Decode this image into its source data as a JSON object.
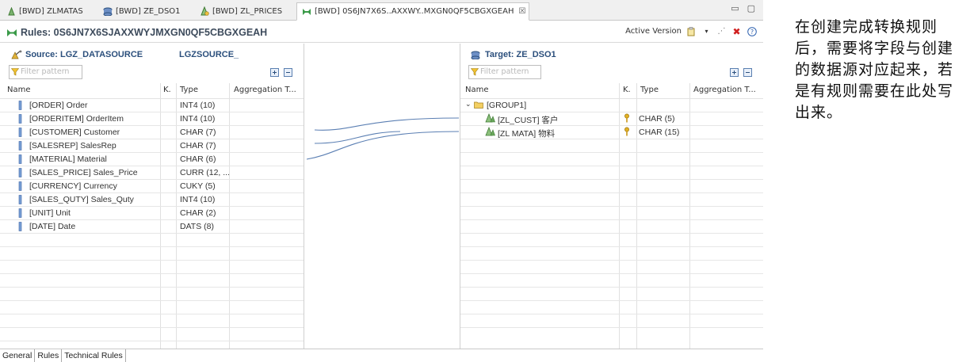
{
  "tabs": [
    {
      "label": "[BWD] ZLMATAS",
      "icon": "transformation-icon",
      "active": false
    },
    {
      "label": "[BWD] ZE_DSO1",
      "icon": "datastore-icon",
      "active": false
    },
    {
      "label": "[BWD] ZL_PRICES",
      "icon": "infoobject-icon",
      "active": false
    },
    {
      "label": "[BWD] 0S6JN7X6S..AXXWY..MXGN0QF5CBGXGEAH",
      "icon": "rules-icon",
      "active": true
    }
  ],
  "header": {
    "title": "Rules: 0S6JN7X6SJAXXWYJMXGN0QF5CBGXGEAH",
    "active_version_label": "Active Version"
  },
  "source": {
    "title": "Source: LGZ_DATASOURCE",
    "subtitle": "LGZSOURCE_",
    "filter_placeholder": "Filter pattern",
    "columns": {
      "name": "Name",
      "key": "K.",
      "type": "Type",
      "agg": "Aggregation T..."
    },
    "rows": [
      {
        "name": "[ORDER] Order",
        "type": "INT4 (10)"
      },
      {
        "name": "[ORDERITEM] OrderItem",
        "type": "INT4 (10)"
      },
      {
        "name": "[CUSTOMER] Customer",
        "type": "CHAR (7)"
      },
      {
        "name": "[SALESREP] SalesRep",
        "type": "CHAR (7)"
      },
      {
        "name": "[MATERIAL] Material",
        "type": "CHAR (6)"
      },
      {
        "name": "[SALES_PRICE] Sales_Price",
        "type": "CURR (12, ..."
      },
      {
        "name": "[CURRENCY] Currency",
        "type": "CUKY (5)"
      },
      {
        "name": "[SALES_QUTY] Sales_Quty",
        "type": "INT4 (10)"
      },
      {
        "name": "[UNIT] Unit",
        "type": "CHAR (2)"
      },
      {
        "name": "[DATE] Date",
        "type": "DATS (8)"
      }
    ]
  },
  "target": {
    "title": "Target: ZE_DSO1",
    "filter_placeholder": "Filter pattern",
    "columns": {
      "name": "Name",
      "key": "K.",
      "type": "Type",
      "agg": "Aggregation T..."
    },
    "group": "[GROUP1]",
    "rows": [
      {
        "name": "[ZL_CUST] 客户",
        "type": "CHAR (5)"
      },
      {
        "name": "[ZL MATA] 物料",
        "type": "CHAR (15)"
      }
    ]
  },
  "bottom_tabs": [
    "General",
    "Rules",
    "Technical Rules"
  ],
  "annotation": "在创建完成转换规则后，需要将字段与创建的数据源对应起来，若是有规则需要在此处写出来。",
  "colors": {
    "accent": "#2b4f7c",
    "connector": "#5b7fb3",
    "key_icon": "#d8a21a"
  }
}
